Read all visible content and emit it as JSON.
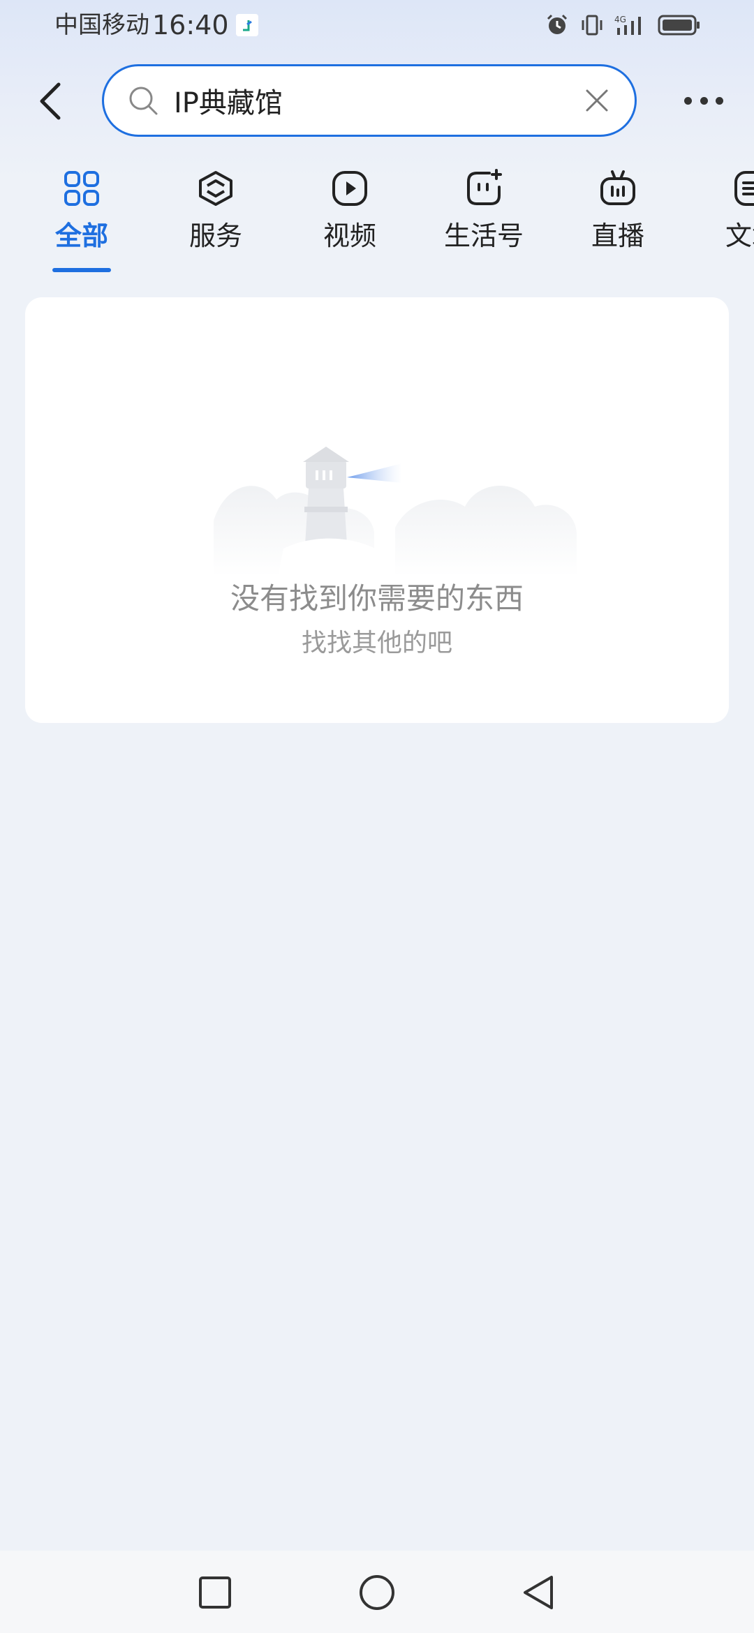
{
  "status_bar": {
    "carrier": "中国移动",
    "time": "16:40",
    "network": "4G"
  },
  "search": {
    "query": "IP典藏馆"
  },
  "tabs": [
    {
      "label": "全部",
      "icon": "grid-icon",
      "active": true
    },
    {
      "label": "服务",
      "icon": "service-cube-icon",
      "active": false
    },
    {
      "label": "视频",
      "icon": "play-icon",
      "active": false
    },
    {
      "label": "生活号",
      "icon": "life-account-icon",
      "active": false
    },
    {
      "label": "直播",
      "icon": "tv-live-icon",
      "active": false
    },
    {
      "label": "文章",
      "icon": "article-icon",
      "active": false
    }
  ],
  "empty_state": {
    "title": "没有找到你需要的东西",
    "subtitle": "找找其他的吧"
  },
  "colors": {
    "accent": "#1e6fe0",
    "background": "#eef2f8",
    "muted_text": "#8c8c8c"
  }
}
